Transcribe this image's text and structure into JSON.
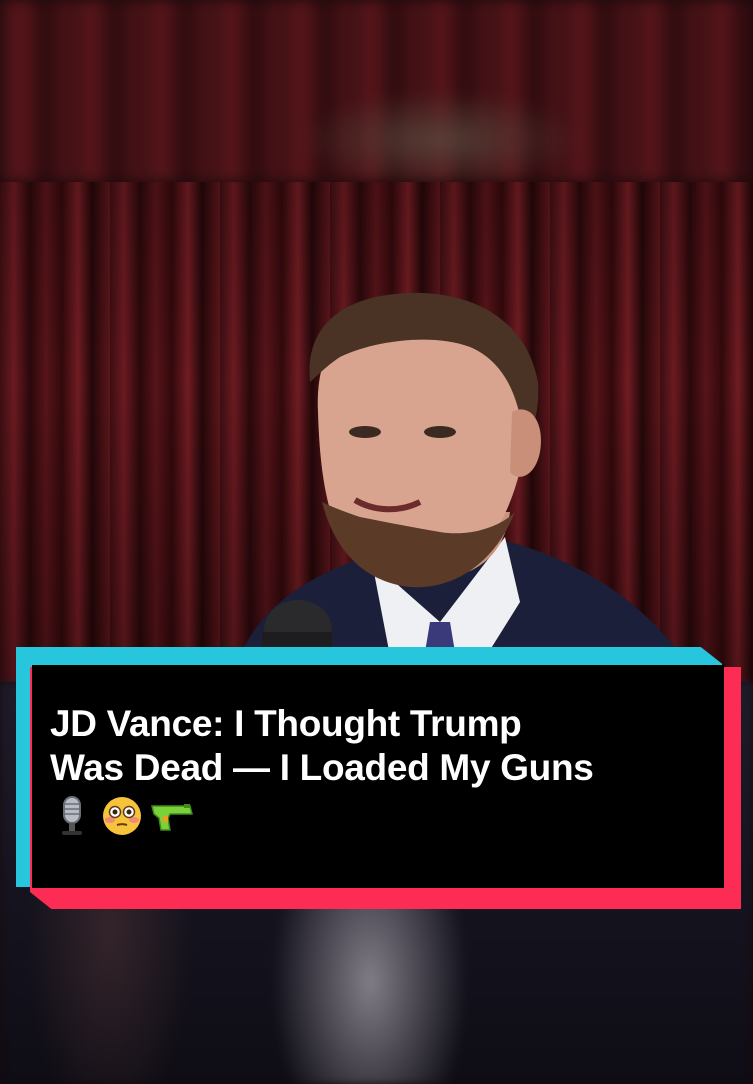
{
  "caption": {
    "line1": "JD Vance: I Thought Trump",
    "line2": "Was Dead — I Loaded My Guns",
    "emojis": [
      "studio-microphone-icon",
      "flushed-face-icon",
      "water-pistol-icon"
    ]
  },
  "colors": {
    "accent_cyan": "#27c6dc",
    "accent_red": "#fc2c55",
    "caption_bg": "#000000",
    "caption_text": "#ffffff",
    "curtain": "#5a161b"
  }
}
